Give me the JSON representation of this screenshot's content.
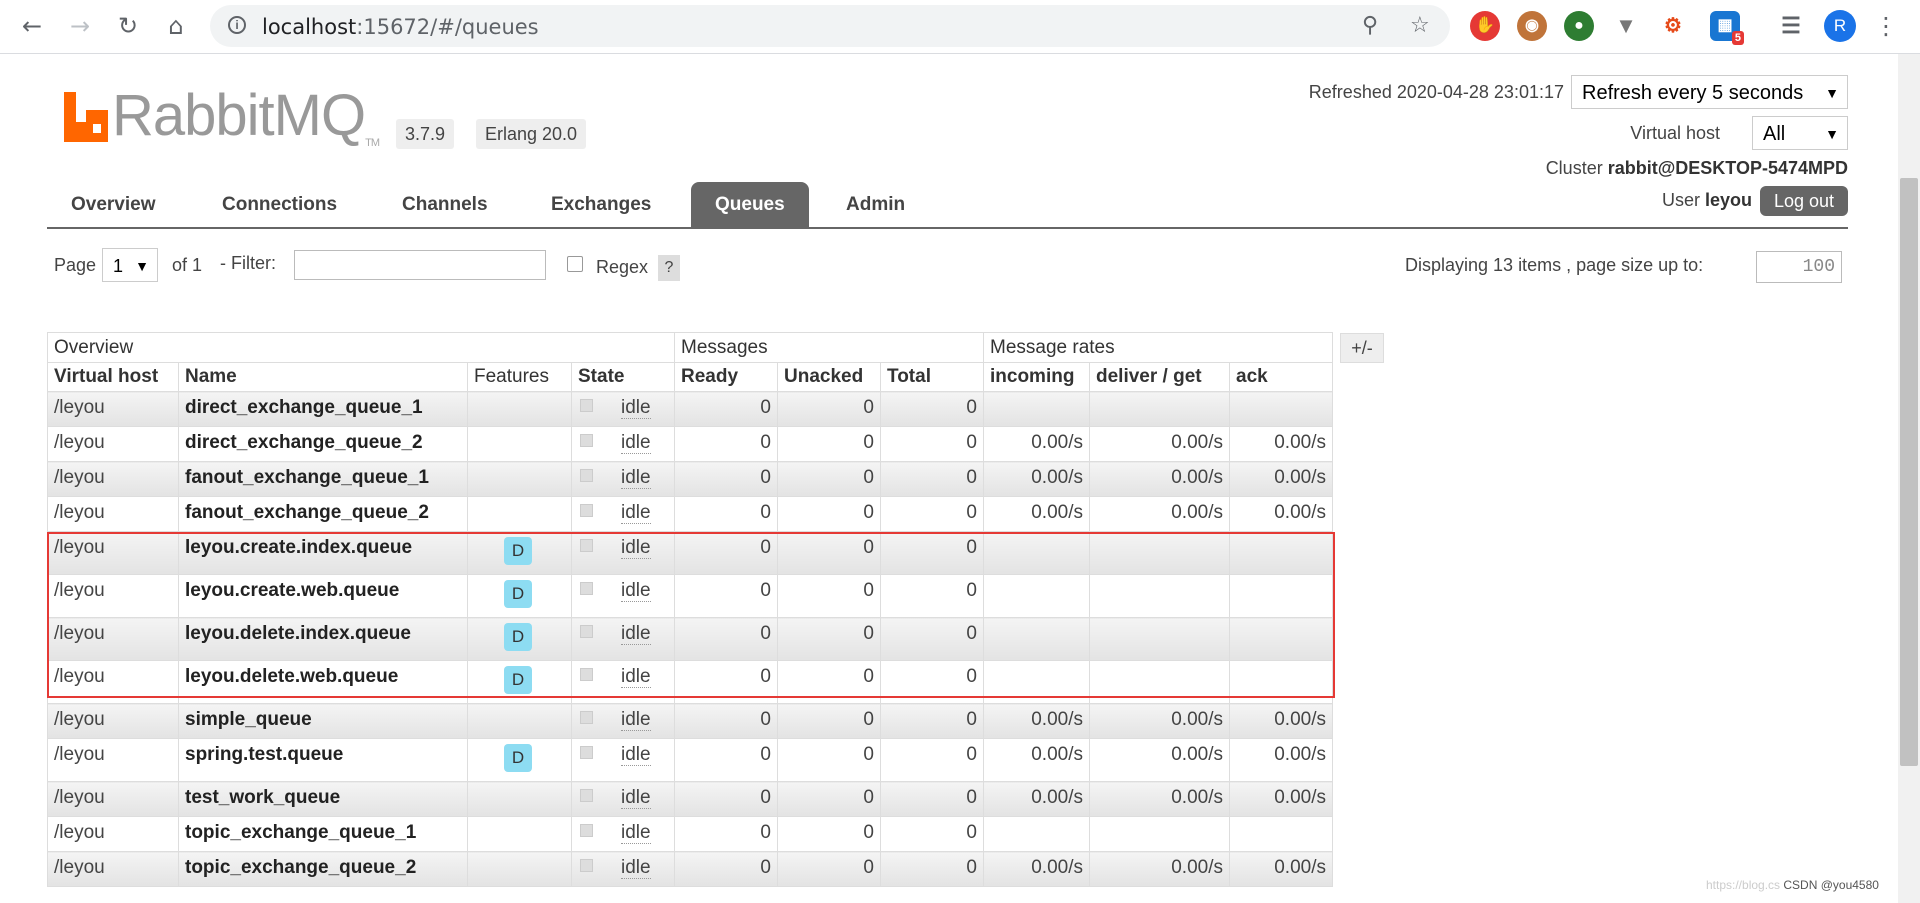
{
  "browser": {
    "url_host": "localhost",
    "url_rest": ":15672/#/queues",
    "profile_initial": "R",
    "extension_badge": "5"
  },
  "app": {
    "logo_text": "RabbitMQ",
    "logo_tm": "TM",
    "version": "3.7.9",
    "erlang": "Erlang 20.0",
    "refreshed_label": "Refreshed 2020-04-28 23:01:17",
    "refresh_select": "Refresh every 5 seconds",
    "vhost_label": "Virtual host",
    "vhost_value": "All",
    "cluster_label": "Cluster",
    "cluster_value": "rabbit@DESKTOP-5474MPD",
    "user_label": "User",
    "user_value": "leyou",
    "logout_label": "Log out"
  },
  "tabs": [
    "Overview",
    "Connections",
    "Channels",
    "Exchanges",
    "Queues",
    "Admin"
  ],
  "active_tab": "Queues",
  "paging": {
    "page_label": "Page",
    "page_value": "1",
    "of_label": "of 1",
    "filter_label": "- Filter:",
    "regex_label": "Regex",
    "help_label": "?",
    "displaying": "Displaying 13 items , page size up to:",
    "page_size": "100"
  },
  "table": {
    "groups": [
      "Overview",
      "Messages",
      "Message rates"
    ],
    "toggle_label": "+/-",
    "columns": [
      "Virtual host",
      "Name",
      "Features",
      "State",
      "Ready",
      "Unacked",
      "Total",
      "incoming",
      "deliver / get",
      "ack"
    ],
    "rows": [
      {
        "vhost": "/leyou",
        "name": "direct_exchange_queue_1",
        "feature": "",
        "state": "idle",
        "ready": "0",
        "unacked": "0",
        "total": "0",
        "incoming": "",
        "deliver": "",
        "ack": ""
      },
      {
        "vhost": "/leyou",
        "name": "direct_exchange_queue_2",
        "feature": "",
        "state": "idle",
        "ready": "0",
        "unacked": "0",
        "total": "0",
        "incoming": "0.00/s",
        "deliver": "0.00/s",
        "ack": "0.00/s"
      },
      {
        "vhost": "/leyou",
        "name": "fanout_exchange_queue_1",
        "feature": "",
        "state": "idle",
        "ready": "0",
        "unacked": "0",
        "total": "0",
        "incoming": "0.00/s",
        "deliver": "0.00/s",
        "ack": "0.00/s"
      },
      {
        "vhost": "/leyou",
        "name": "fanout_exchange_queue_2",
        "feature": "",
        "state": "idle",
        "ready": "0",
        "unacked": "0",
        "total": "0",
        "incoming": "0.00/s",
        "deliver": "0.00/s",
        "ack": "0.00/s"
      },
      {
        "vhost": "/leyou",
        "name": "leyou.create.index.queue",
        "feature": "D",
        "state": "idle",
        "ready": "0",
        "unacked": "0",
        "total": "0",
        "incoming": "",
        "deliver": "",
        "ack": ""
      },
      {
        "vhost": "/leyou",
        "name": "leyou.create.web.queue",
        "feature": "D",
        "state": "idle",
        "ready": "0",
        "unacked": "0",
        "total": "0",
        "incoming": "",
        "deliver": "",
        "ack": ""
      },
      {
        "vhost": "/leyou",
        "name": "leyou.delete.index.queue",
        "feature": "D",
        "state": "idle",
        "ready": "0",
        "unacked": "0",
        "total": "0",
        "incoming": "",
        "deliver": "",
        "ack": ""
      },
      {
        "vhost": "/leyou",
        "name": "leyou.delete.web.queue",
        "feature": "D",
        "state": "idle",
        "ready": "0",
        "unacked": "0",
        "total": "0",
        "incoming": "",
        "deliver": "",
        "ack": ""
      },
      {
        "vhost": "/leyou",
        "name": "simple_queue",
        "feature": "",
        "state": "idle",
        "ready": "0",
        "unacked": "0",
        "total": "0",
        "incoming": "0.00/s",
        "deliver": "0.00/s",
        "ack": "0.00/s"
      },
      {
        "vhost": "/leyou",
        "name": "spring.test.queue",
        "feature": "D",
        "state": "idle",
        "ready": "0",
        "unacked": "0",
        "total": "0",
        "incoming": "0.00/s",
        "deliver": "0.00/s",
        "ack": "0.00/s"
      },
      {
        "vhost": "/leyou",
        "name": "test_work_queue",
        "feature": "",
        "state": "idle",
        "ready": "0",
        "unacked": "0",
        "total": "0",
        "incoming": "0.00/s",
        "deliver": "0.00/s",
        "ack": "0.00/s"
      },
      {
        "vhost": "/leyou",
        "name": "topic_exchange_queue_1",
        "feature": "",
        "state": "idle",
        "ready": "0",
        "unacked": "0",
        "total": "0",
        "incoming": "",
        "deliver": "",
        "ack": ""
      },
      {
        "vhost": "/leyou",
        "name": "topic_exchange_queue_2",
        "feature": "",
        "state": "idle",
        "ready": "0",
        "unacked": "0",
        "total": "0",
        "incoming": "0.00/s",
        "deliver": "0.00/s",
        "ack": "0.00/s"
      }
    ]
  },
  "watermark": {
    "faint": "https://blog.cs",
    "text": "CSDN @you4580"
  },
  "colors": {
    "logo_orange": "#f60",
    "tab_active": "#666",
    "highlight_red": "#e53935",
    "durable_badge": "#8ddcf2"
  }
}
